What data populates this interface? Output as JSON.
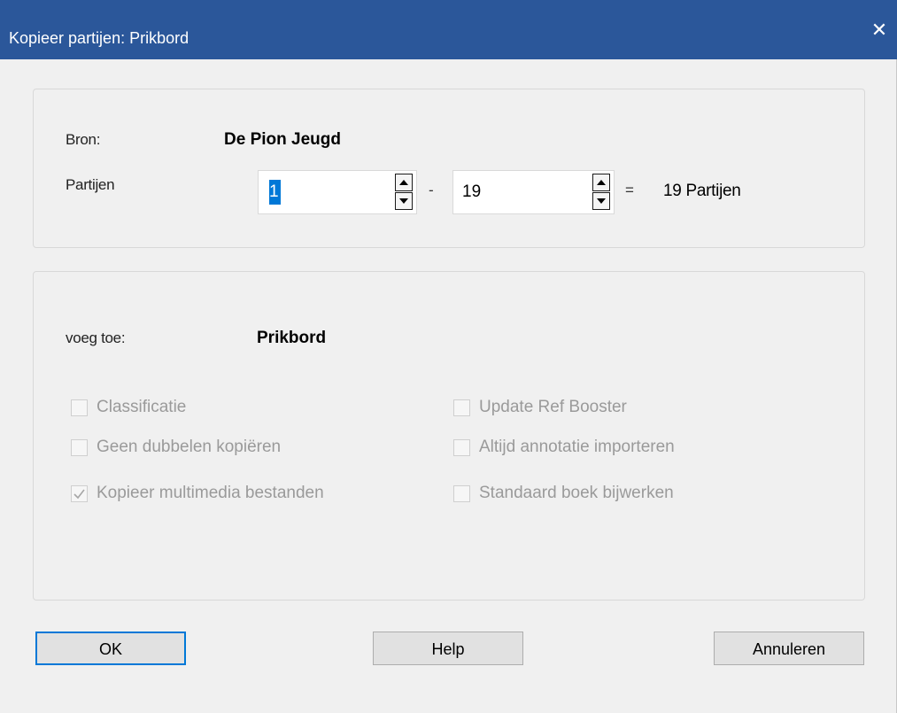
{
  "window": {
    "title": "Kopieer partijen: Prikbord",
    "close_glyph": "✕"
  },
  "source": {
    "bron_label": "Bron:",
    "bron_value": "De Pion Jeugd",
    "partijen_label": "Partijen",
    "from_value": "1",
    "range_separator": "-",
    "to_value": "19",
    "equals": "=",
    "count_text": "19 Partijen"
  },
  "target": {
    "voeg_label": "voeg toe:",
    "voeg_value": "Prikbord",
    "options": [
      {
        "label": "Classificatie",
        "checked": false,
        "enabled": false
      },
      {
        "label": "Geen dubbelen kopiëren",
        "checked": false,
        "enabled": false
      },
      {
        "label": "Kopieer multimedia bestanden",
        "checked": true,
        "enabled": false
      },
      {
        "label": "Update Ref Booster",
        "checked": false,
        "enabled": false
      },
      {
        "label": "Altijd annotatie importeren",
        "checked": false,
        "enabled": false
      },
      {
        "label": "Standaard boek bijwerken",
        "checked": false,
        "enabled": false
      }
    ]
  },
  "buttons": {
    "ok": "OK",
    "help": "Help",
    "cancel": "Annuleren"
  },
  "colors": {
    "titlebar": "#2b579a",
    "default_button_border": "#0078d7",
    "disabled_text": "#9a9a9a"
  }
}
